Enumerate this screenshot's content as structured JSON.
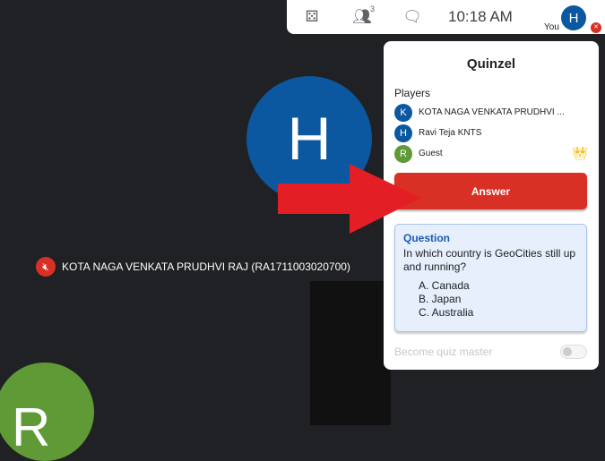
{
  "topbar": {
    "activities_icon": "dice-icon",
    "people_icon": "people-icon",
    "people_count": "3",
    "chat_icon": "chat-icon",
    "time": "10:18  AM",
    "you_label": "You",
    "me_initial": "H"
  },
  "stage": {
    "main_initial": "H",
    "speaker_name": "KOTA NAGA VENKATA PRUDHVI RAJ (RA1711003020700)",
    "tile_initial": "R"
  },
  "panel": {
    "title": "Quinzel",
    "players_heading": "Players",
    "players": [
      {
        "initial": "K",
        "name": "KOTA NAGA VENKATA PRUDHVI ...",
        "color": "#0b57a0"
      },
      {
        "initial": "H",
        "name": "Ravi Teja KNTS",
        "color": "#0b57a0"
      },
      {
        "initial": "R",
        "name": "Guest",
        "color": "#5f9a37"
      }
    ],
    "answer_label": "Answer",
    "question": {
      "heading": "Question",
      "text": "In which country is GeoCities still up and running?",
      "options": [
        "A.  Canada",
        "B.  Japan",
        "C.  Australia"
      ]
    },
    "become_master_label": "Become quiz master"
  }
}
